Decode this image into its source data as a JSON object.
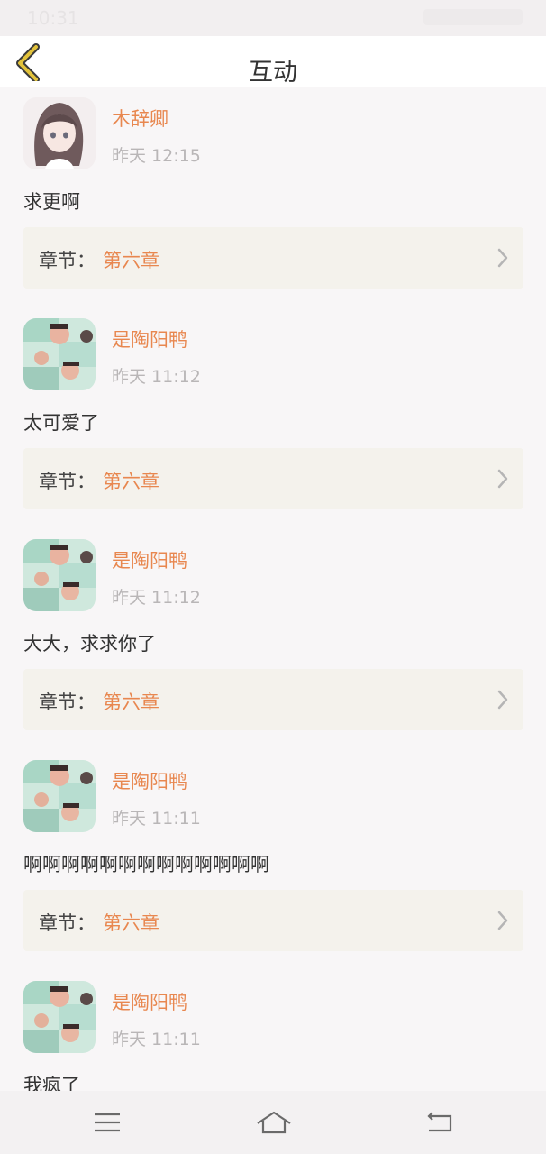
{
  "status_bar": {
    "time": "10:31"
  },
  "header": {
    "title": "互动"
  },
  "chapter_prefix": "章节：",
  "comments": [
    {
      "user": "木辞卿",
      "time": "昨天 12:15",
      "text": "求更啊",
      "chapter": "第六章",
      "avatar": "girl-avatar"
    },
    {
      "user": "是陶阳鸭",
      "time": "昨天 11:12",
      "text": "太可爱了",
      "chapter": "第六章",
      "avatar": "collage-avatar"
    },
    {
      "user": "是陶阳鸭",
      "time": "昨天 11:12",
      "text": "大大，求求你了",
      "chapter": "第六章",
      "avatar": "collage-avatar"
    },
    {
      "user": "是陶阳鸭",
      "time": "昨天 11:11",
      "text": "啊啊啊啊啊啊啊啊啊啊啊啊啊",
      "chapter": "第六章",
      "avatar": "collage-avatar"
    },
    {
      "user": "是陶阳鸭",
      "time": "昨天 11:11",
      "text": "我疯了",
      "chapter": "",
      "avatar": "collage-avatar"
    }
  ],
  "colors": {
    "accent": "#e8874f",
    "back_icon": "#e2c23a",
    "chapter_bg": "#f4f2ec"
  }
}
